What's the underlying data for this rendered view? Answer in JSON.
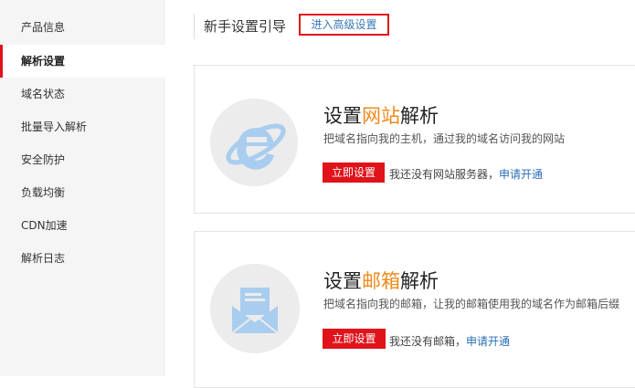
{
  "sidebar": {
    "items": [
      {
        "label": "产品信息",
        "active": false
      },
      {
        "label": "解析设置",
        "active": true
      },
      {
        "label": "域名状态",
        "active": false
      },
      {
        "label": "批量导入解析",
        "active": false
      },
      {
        "label": "安全防护",
        "active": false
      },
      {
        "label": "负载均衡",
        "active": false
      },
      {
        "label": "CDN加速",
        "active": false
      },
      {
        "label": "解析日志",
        "active": false
      }
    ]
  },
  "header": {
    "title": "新手设置引导",
    "advanced_link": "进入高级设置"
  },
  "cards": [
    {
      "icon": "ie-browser-icon",
      "title_prefix": "设置",
      "title_highlight": "网站",
      "title_suffix": "解析",
      "description": "把域名指向我的主机，通过我的域名访问我的网站",
      "button": "立即设置",
      "note": "我还没有网站服务器，",
      "note_link": "申请开通"
    },
    {
      "icon": "mail-envelope-icon",
      "title_prefix": "设置",
      "title_highlight": "邮箱",
      "title_suffix": "解析",
      "description": "把域名指向我的邮箱，让我的邮箱使用我的域名作为邮箱后缀",
      "button": "立即设置",
      "note": "我还没有邮箱，",
      "note_link": "申请开通"
    }
  ],
  "colors": {
    "accent_red": "#e0131b",
    "highlight_orange": "#f2891a",
    "link_blue": "#2a6fb5",
    "icon_blue": "#a9cdef"
  }
}
